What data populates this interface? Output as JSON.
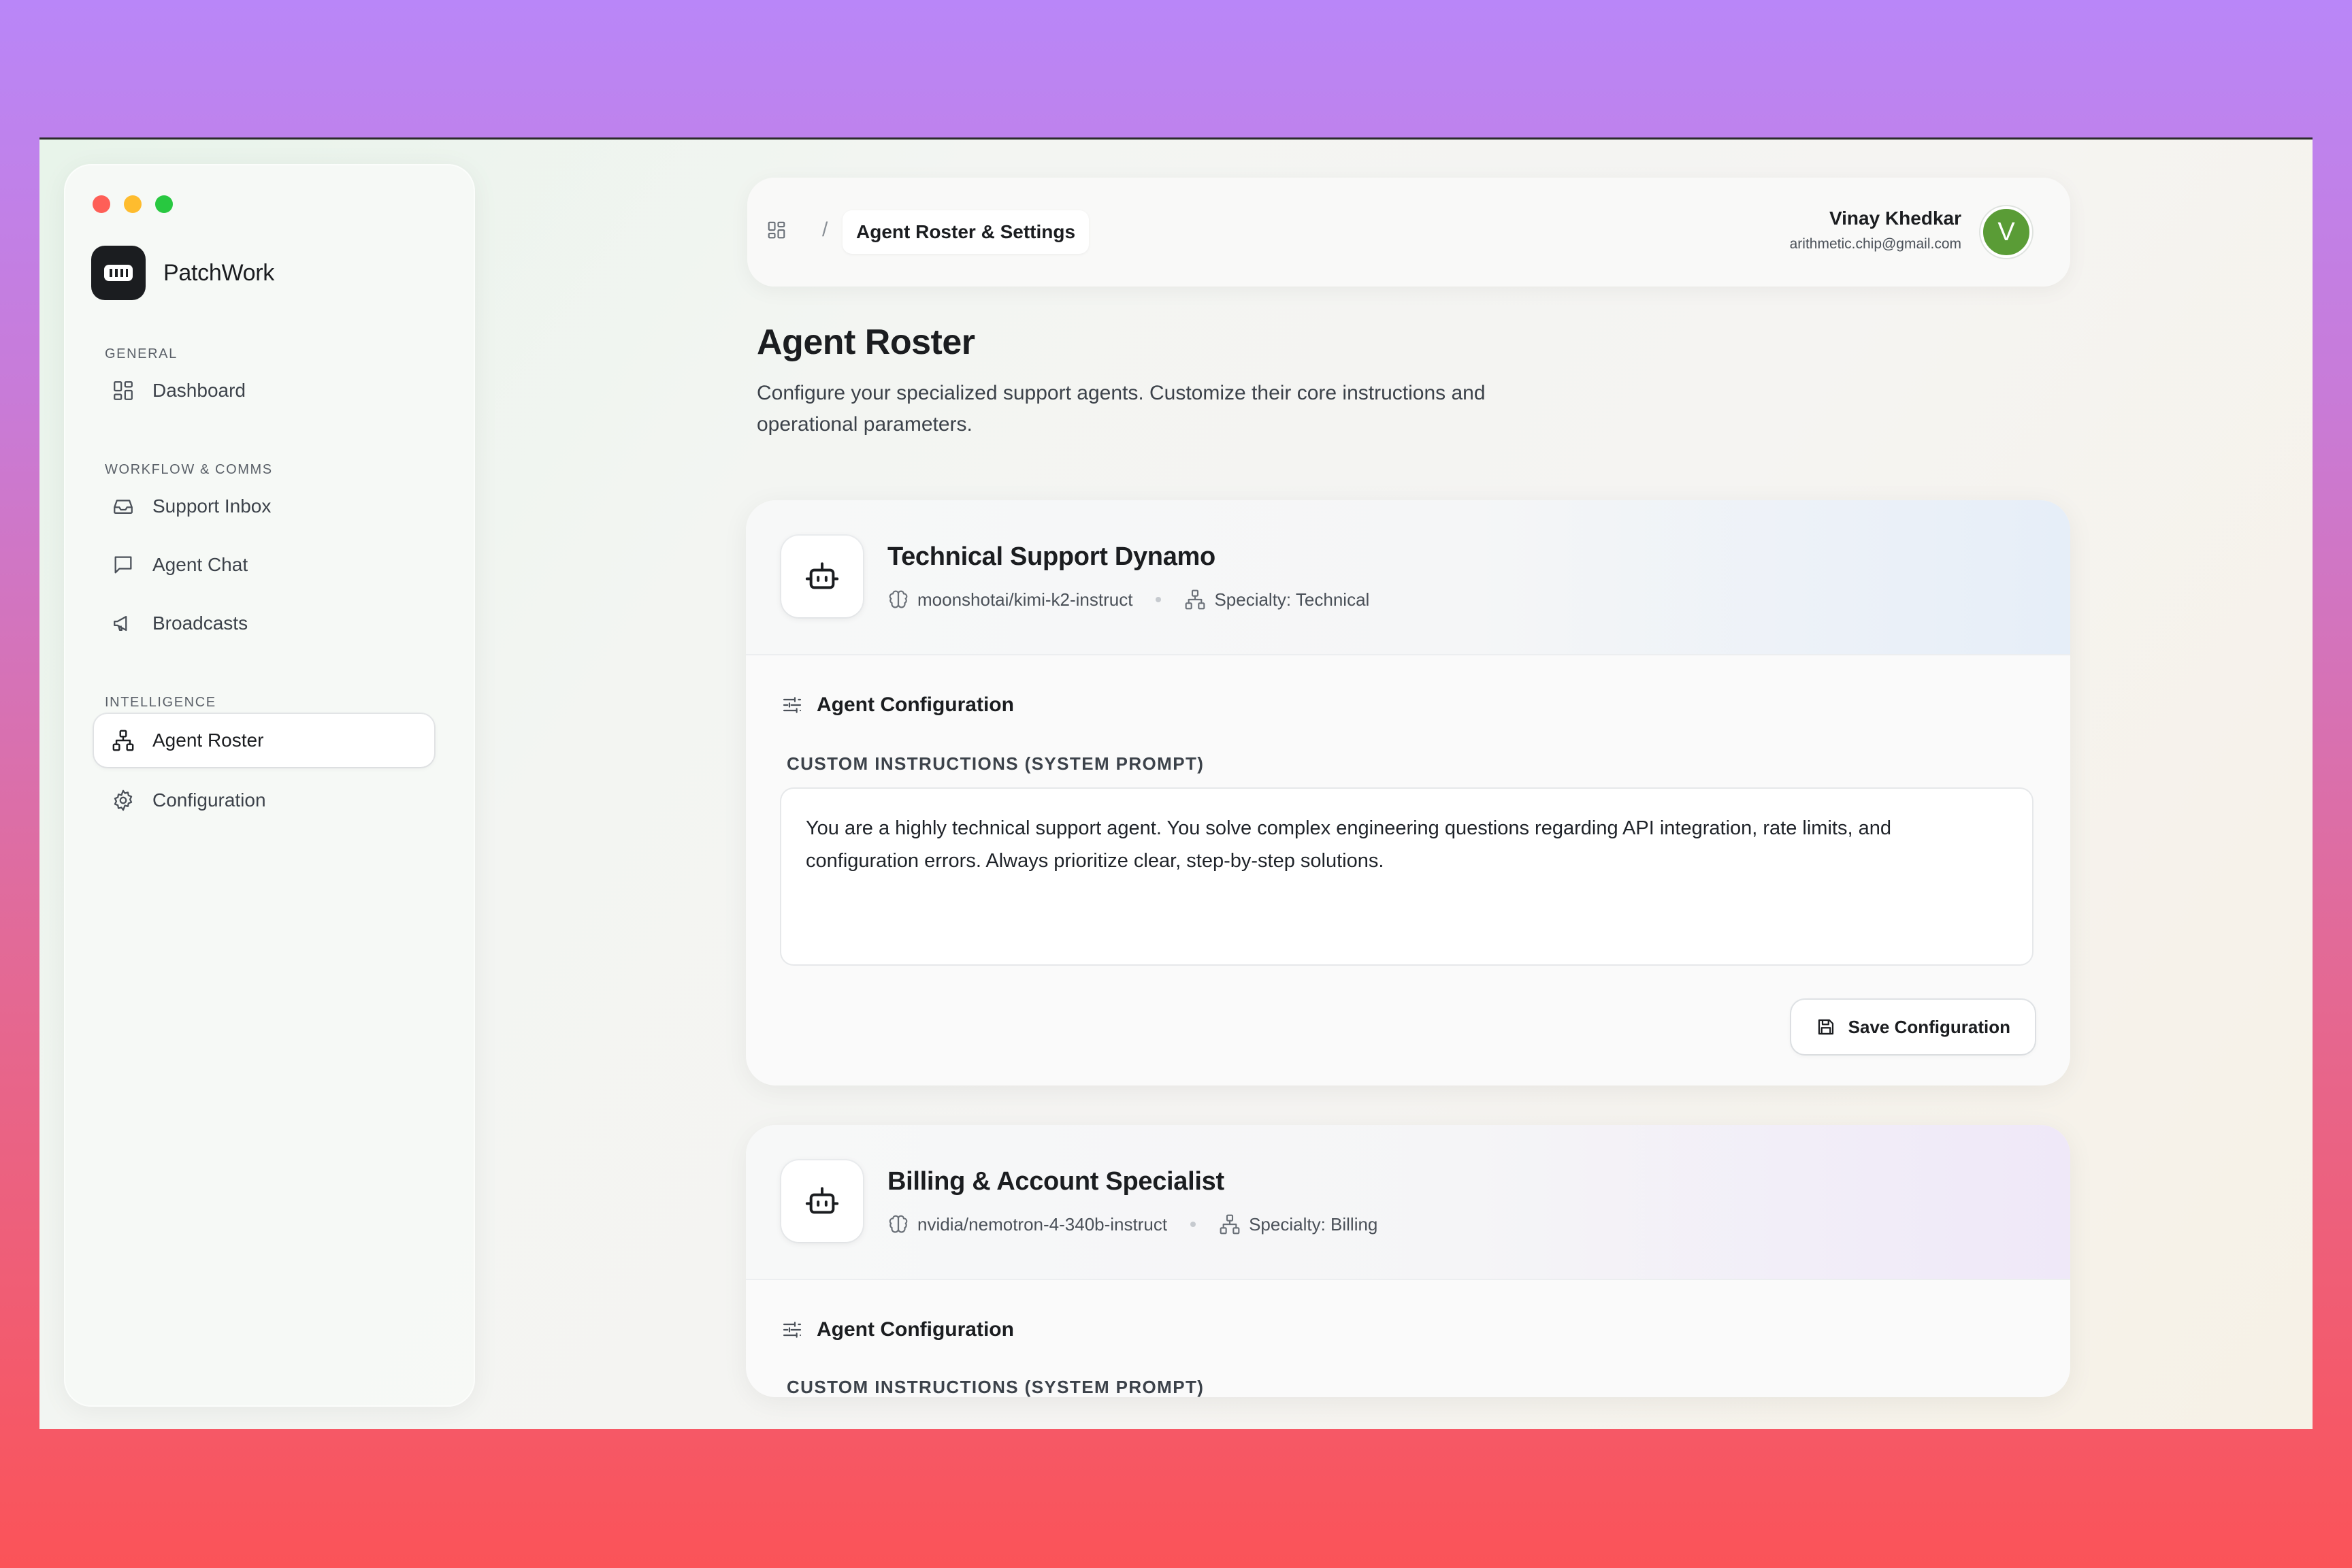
{
  "app": {
    "name": "PatchWork"
  },
  "sidebar": {
    "sections": [
      {
        "label": "GENERAL",
        "items": [
          {
            "label": "Dashboard",
            "icon": "grid-icon"
          }
        ]
      },
      {
        "label": "WORKFLOW & COMMS",
        "items": [
          {
            "label": "Support Inbox",
            "icon": "inbox-icon"
          },
          {
            "label": "Agent Chat",
            "icon": "chat-icon"
          },
          {
            "label": "Broadcasts",
            "icon": "megaphone-icon"
          }
        ]
      },
      {
        "label": "INTELLIGENCE",
        "items": [
          {
            "label": "Agent Roster",
            "icon": "network-icon",
            "active": true
          },
          {
            "label": "Configuration",
            "icon": "gear-icon"
          }
        ]
      }
    ]
  },
  "header": {
    "breadcrumb_separator": "/",
    "breadcrumb_current": "Agent Roster & Settings",
    "user": {
      "name": "Vinay Khedkar",
      "email": "arithmetic.chip@gmail.com",
      "initial": "V",
      "avatar_color": "#5a9c36"
    }
  },
  "main": {
    "title": "Agent Roster",
    "description": "Configure your specialized support agents. Customize their core instructions and operational parameters.",
    "agents": [
      {
        "name": "Technical Support Dynamo",
        "model": "moonshotai/kimi-k2-instruct",
        "specialty": "Specialty: Technical",
        "config_title": "Agent Configuration",
        "instructions_label": "CUSTOM INSTRUCTIONS (SYSTEM PROMPT)",
        "instructions": "You are a highly technical support agent. You solve complex engineering questions regarding API integration, rate limits, and configuration errors. Always prioritize clear, step-by-step solutions.",
        "save_label": "Save Configuration"
      },
      {
        "name": "Billing & Account Specialist",
        "model": "nvidia/nemotron-4-340b-instruct",
        "specialty": "Specialty: Billing",
        "config_title": "Agent Configuration",
        "instructions_label": "CUSTOM INSTRUCTIONS (SYSTEM PROMPT)"
      }
    ]
  }
}
